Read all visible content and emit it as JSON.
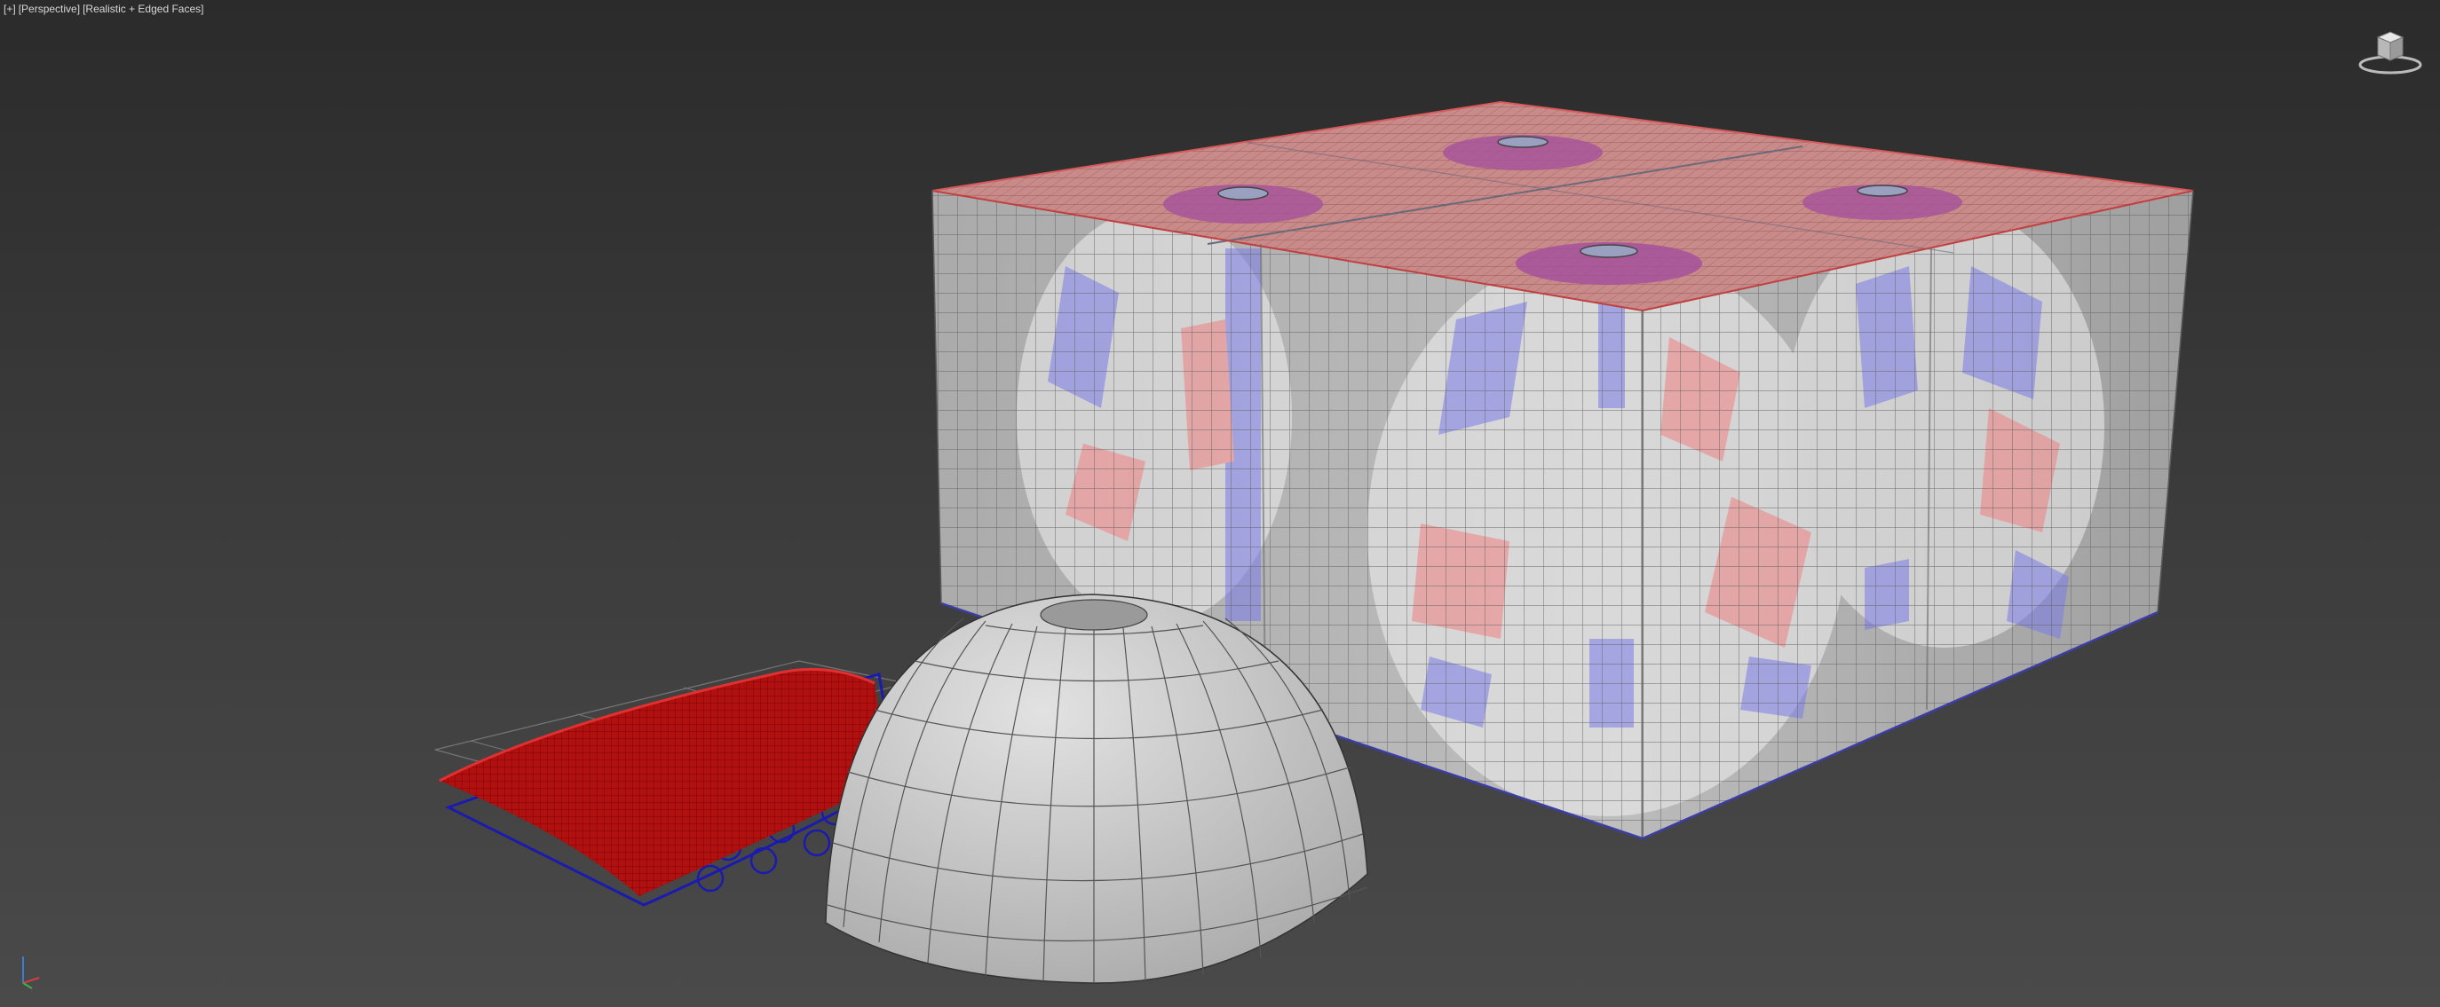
{
  "viewport": {
    "menu_label": "[+]",
    "view_label": "[Perspective]",
    "shading_label": "[Realistic + Edged Faces]"
  },
  "viewcube": {
    "icon": "viewcube-icon"
  },
  "axis": {
    "x": "x",
    "y": "y",
    "z": "z"
  },
  "colors": {
    "background_top": "#2b2b2b",
    "background_bottom": "#4a4a4a",
    "box_top": "#c98a8a",
    "box_side": "#b8b8b8",
    "grid_line": "#555555",
    "patch_red": "#b01010",
    "patch_blue": "#1a1ab0",
    "dome": "#d4d4d4"
  }
}
